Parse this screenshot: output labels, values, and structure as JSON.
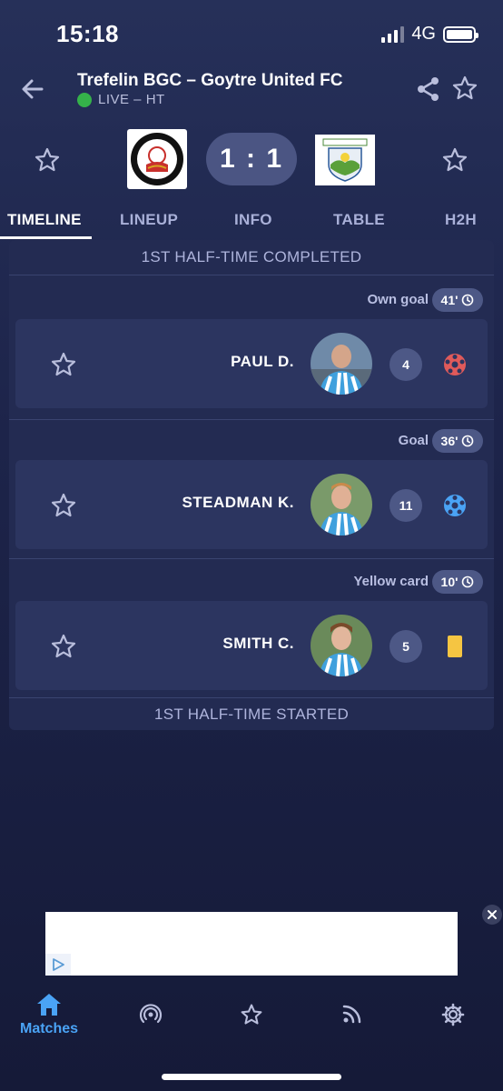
{
  "status_bar": {
    "time": "15:18",
    "network": "4G"
  },
  "header": {
    "title": "Trefelin BGC – Goytre United FC",
    "live_status": "LIVE – HT"
  },
  "score": {
    "display": "1 : 1"
  },
  "tabs": [
    {
      "label": "TIMELINE",
      "active": true
    },
    {
      "label": "LINEUP"
    },
    {
      "label": "INFO"
    },
    {
      "label": "TABLE"
    },
    {
      "label": "H2H"
    }
  ],
  "timeline": {
    "top_header": "1ST HALF-TIME COMPLETED",
    "bottom_header": "1ST HALF-TIME STARTED",
    "events": [
      {
        "type": "Own goal",
        "minute": "41'",
        "player": "PAUL D.",
        "number": "4",
        "icon": "own-goal-ball-icon",
        "icon_color": "#e05a5a"
      },
      {
        "type": "Goal",
        "minute": "36'",
        "player": "STEADMAN K.",
        "number": "11",
        "icon": "goal-ball-icon",
        "icon_color": "#4aa3f5"
      },
      {
        "type": "Yellow card",
        "minute": "10'",
        "player": "SMITH C.",
        "number": "5",
        "icon": "yellow-card-icon",
        "icon_color": "#f5c542"
      }
    ]
  },
  "bottom_nav": [
    {
      "label": "Matches",
      "icon": "home-icon",
      "active": true
    },
    {
      "label": "",
      "icon": "live-broadcast-icon"
    },
    {
      "label": "",
      "icon": "star-icon"
    },
    {
      "label": "",
      "icon": "rss-icon"
    },
    {
      "label": "",
      "icon": "gear-icon"
    }
  ],
  "colors": {
    "accent": "#4aa3f5",
    "live": "#35b24a",
    "background": "#1d244a",
    "card": "#2c3560"
  }
}
